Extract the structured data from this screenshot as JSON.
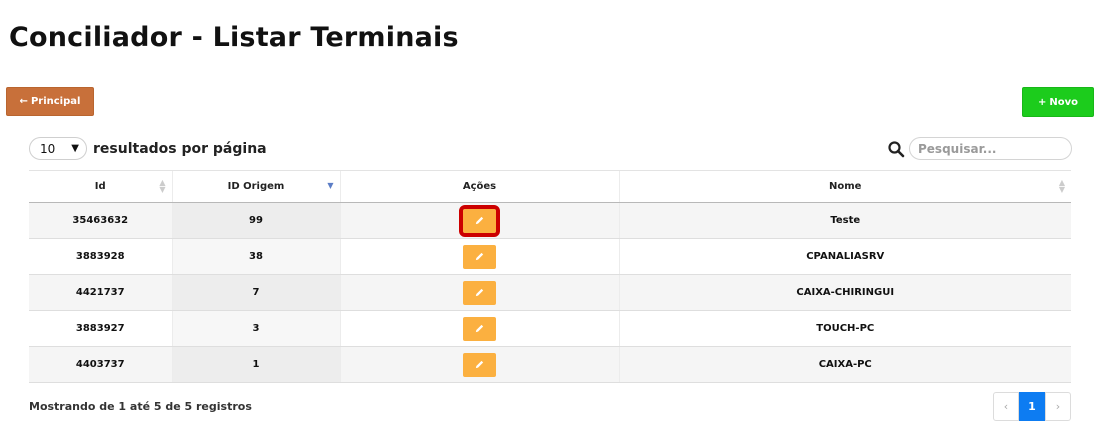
{
  "page": {
    "title": "Conciliador - Listar Terminais"
  },
  "actions": {
    "back_label": "Principal",
    "new_label": "Novo"
  },
  "length": {
    "value": "10",
    "label": "resultados por página"
  },
  "search": {
    "placeholder": "Pesquisar..."
  },
  "table": {
    "columns": [
      "Id",
      "ID Origem",
      "Ações",
      "Nome"
    ],
    "sorted_column": "ID Origem",
    "sort_direction": "descending",
    "rows": [
      {
        "id": "35463632",
        "id_origem": "99",
        "nome": "Teste",
        "highlighted": true
      },
      {
        "id": "3883928",
        "id_origem": "38",
        "nome": "CPANALIASRV",
        "highlighted": false
      },
      {
        "id": "4421737",
        "id_origem": "7",
        "nome": "CAIXA-CHIRINGUI",
        "highlighted": false
      },
      {
        "id": "3883927",
        "id_origem": "3",
        "nome": "TOUCH-PC",
        "highlighted": false
      },
      {
        "id": "4403737",
        "id_origem": "1",
        "nome": "CAIXA-PC",
        "highlighted": false
      }
    ]
  },
  "footer": {
    "info": "Mostrando de 1 até 5 de 5 registros"
  },
  "pagination": {
    "prev": "‹",
    "current": "1",
    "next": "›"
  },
  "icons": {
    "back": "arrow-left-icon",
    "new": "plus-icon",
    "search": "search-icon",
    "edit": "pencil-icon"
  },
  "colors": {
    "principal": "#c8703a",
    "novo": "#1ccc1c",
    "edit": "#fbb040",
    "highlight": "#cc0000",
    "page_active": "#0d7cf2"
  }
}
